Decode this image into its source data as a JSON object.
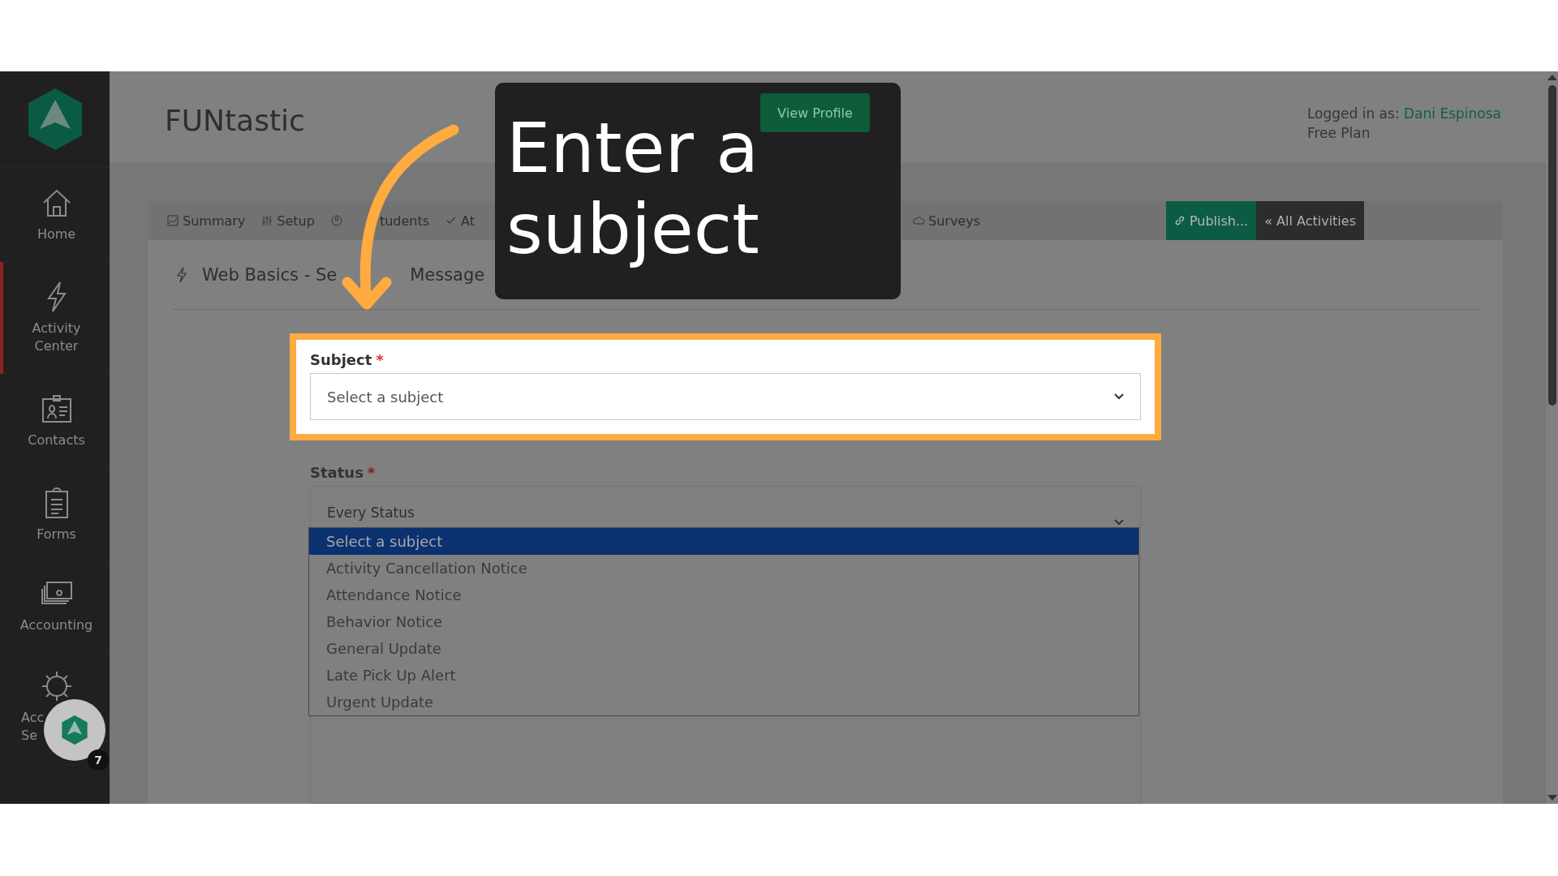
{
  "sidebar": {
    "items": [
      {
        "label": "Home",
        "selected": false
      },
      {
        "label": "Activity Center",
        "selected": true
      },
      {
        "label": "Contacts",
        "selected": false
      },
      {
        "label": "Forms",
        "selected": false
      },
      {
        "label": "Accounting",
        "selected": false
      },
      {
        "label": "Acc Se",
        "selected": false
      }
    ]
  },
  "header": {
    "title": "FUNtastic",
    "view_profile": "View Profile",
    "logged_in_label": "Logged in as:",
    "user": "Dani Espinosa",
    "plan": "Free Plan"
  },
  "tabs": [
    {
      "label": "Summary",
      "kind": "tab"
    },
    {
      "label": "Setup",
      "kind": "tab"
    },
    {
      "label": "tudents",
      "kind": "tab"
    },
    {
      "label": "At",
      "kind": "tab"
    },
    {
      "label": "Surveys",
      "kind": "tab"
    },
    {
      "label": "Publish...",
      "kind": "publish"
    },
    {
      "label": "« All Activities",
      "kind": "back"
    }
  ],
  "page_title": [
    "Web Basics - Se",
    "Message"
  ],
  "form": {
    "subject": {
      "label": "Subject",
      "required_mark": "*",
      "placeholder": "Select a subject"
    },
    "status": {
      "label": "Status",
      "required_mark": "*",
      "value": "Every Status",
      "options": [
        {
          "label": "Select a subject",
          "selected": true
        },
        {
          "label": "Activity Cancellation Notice",
          "selected": false
        },
        {
          "label": "Attendance Notice",
          "selected": false
        },
        {
          "label": "Behavior Notice",
          "selected": false
        },
        {
          "label": "General Update",
          "selected": false
        },
        {
          "label": "Late Pick Up Alert",
          "selected": false
        },
        {
          "label": "Urgent Update",
          "selected": false
        }
      ]
    }
  },
  "chat_widget": {
    "badge": "7"
  },
  "callout": {
    "text": "Enter a subject"
  }
}
